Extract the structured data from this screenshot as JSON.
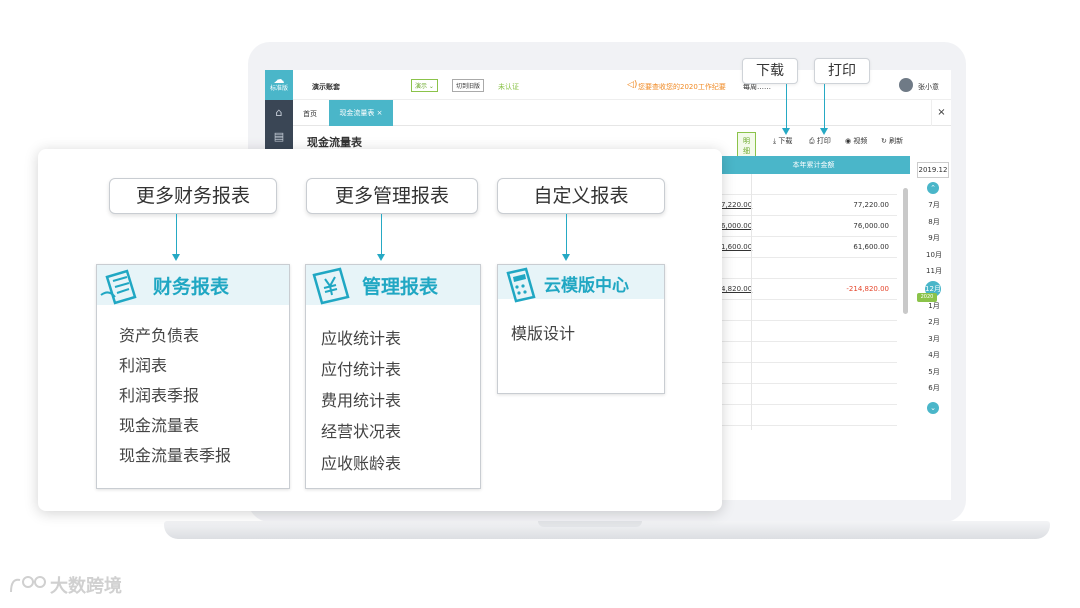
{
  "app": {
    "logo_label": "标准版",
    "company": "演示账套",
    "mode": "演示",
    "switch_label": "切到旧版",
    "verify_status": "未认证",
    "notice": "您要查收您的2020工作纪要",
    "ask": "每周……",
    "user": "张小意"
  },
  "tabs": {
    "home": "首页",
    "active": "现金流量表",
    "active_close": "×",
    "close_all": "×"
  },
  "report": {
    "title": "现金流量表",
    "detail_label": "明细",
    "download_label": "下载",
    "print_label": "打印",
    "video_label": "视频",
    "refresh_label": "刷新",
    "column_header": "本年累计金额",
    "rows": [
      {
        "left": "",
        "right": ""
      },
      {
        "left": "7,220.00",
        "right": "77,220.00"
      },
      {
        "left": "6,000.00",
        "right": "76,000.00"
      },
      {
        "left": "1,600.00",
        "right": "61,600.00"
      },
      {
        "left": "",
        "right": ""
      },
      {
        "left": "4,820.00",
        "right": "-214,820.00"
      },
      {
        "left": "",
        "right": ""
      },
      {
        "left": "",
        "right": ""
      },
      {
        "left": "",
        "right": ""
      },
      {
        "left": "",
        "right": ""
      },
      {
        "left": "",
        "right": ""
      },
      {
        "left": "",
        "right": ""
      }
    ]
  },
  "period": {
    "year": "2019.12",
    "months": [
      "7月",
      "8月",
      "9月",
      "10月",
      "11月"
    ],
    "active_month": "12月",
    "year_tag": "2020",
    "months_after": [
      "1月",
      "2月",
      "3月",
      "4月",
      "5月",
      "6月"
    ]
  },
  "callouts": {
    "download": "下载",
    "print": "打印"
  },
  "overlay": {
    "pills": [
      "更多财务报表",
      "更多管理报表",
      "自定义报表"
    ],
    "panels": [
      {
        "title": "财务报表",
        "icon": "document-pen-icon",
        "items": [
          "资产负债表",
          "利润表",
          "利润表季报",
          "现金流量表",
          "现金流量表季报"
        ]
      },
      {
        "title": "管理报表",
        "icon": "yen-stamp-icon",
        "items": [
          "应收统计表",
          "应付统计表",
          "费用统计表",
          "经营状况表",
          "应收账龄表"
        ]
      },
      {
        "title": "云模版中心",
        "icon": "calculator-icon",
        "items": [
          "模版设计"
        ]
      }
    ],
    "accent": "#20a7c3"
  },
  "watermark": "大数跨境",
  "colors": {
    "accent": "#4ab6c9",
    "green": "#8bc34a",
    "negative": "#e5452b",
    "rail": "#3a4655"
  }
}
